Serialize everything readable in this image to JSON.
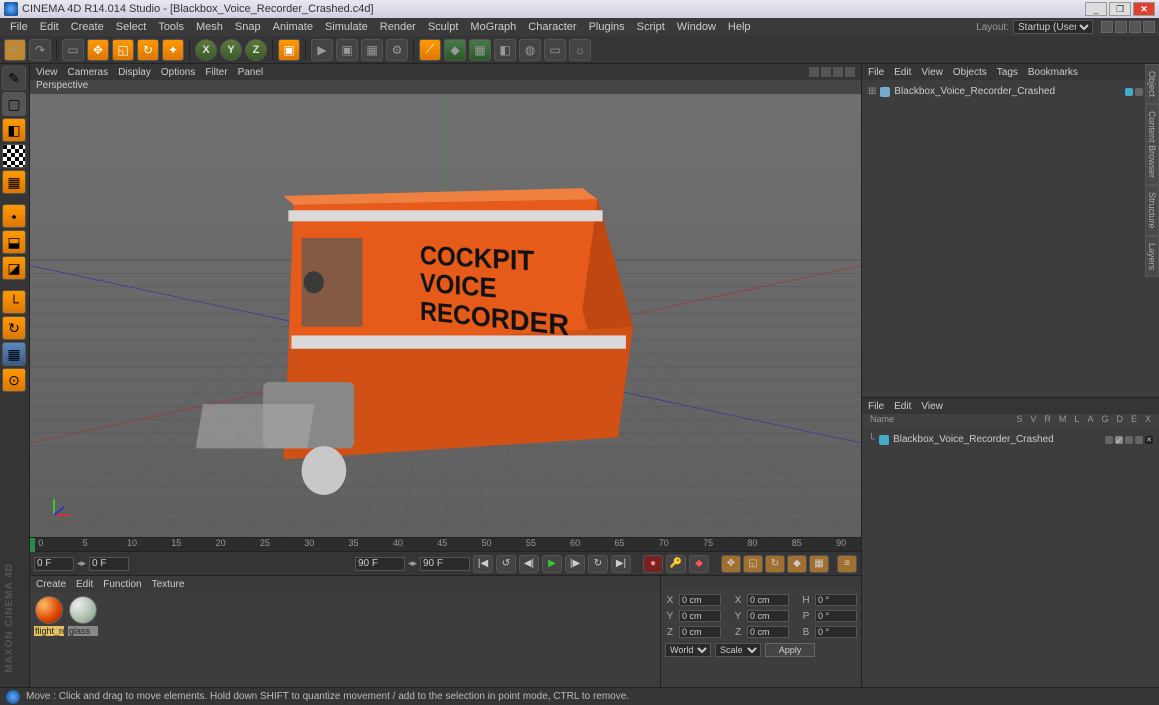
{
  "app": {
    "title": "CINEMA 4D R14.014 Studio - [Blackbox_Voice_Recorder_Crashed.c4d]"
  },
  "menu": [
    "File",
    "Edit",
    "Create",
    "Select",
    "Tools",
    "Mesh",
    "Snap",
    "Animate",
    "Simulate",
    "Render",
    "Sculpt",
    "MoGraph",
    "Character",
    "Plugins",
    "Script",
    "Window",
    "Help"
  ],
  "layout": {
    "label": "Layout:",
    "value": "Startup (User)"
  },
  "viewport": {
    "menu": [
      "View",
      "Cameras",
      "Display",
      "Options",
      "Filter",
      "Panel"
    ],
    "label": "Perspective",
    "model_text": "COCKPIT\nVOICE\nRECORDER"
  },
  "timeline": {
    "start_frame": "0 F",
    "end_frame_in": "90 F",
    "end_frame_out": "90 F",
    "cur_frame": "0 F",
    "ticks": [
      0,
      5,
      10,
      15,
      20,
      25,
      30,
      35,
      40,
      45,
      50,
      55,
      60,
      65,
      70,
      75,
      80,
      85,
      90
    ]
  },
  "materials": {
    "menu": [
      "Create",
      "Edit",
      "Function",
      "Texture"
    ],
    "items": [
      {
        "name": "flight_re",
        "kind": "orange"
      },
      {
        "name": "glass",
        "kind": "glass"
      }
    ]
  },
  "coords": {
    "x": "0 cm",
    "y": "0 cm",
    "z": "0 cm",
    "sx": "0 cm",
    "sy": "0 cm",
    "sz": "0 cm",
    "h": "0 °",
    "p": "0 °",
    "b": "0 °",
    "mode_a": "World",
    "mode_b": "Scale",
    "apply": "Apply"
  },
  "objects": {
    "menu": [
      "File",
      "Edit",
      "View",
      "Objects",
      "Tags",
      "Bookmarks"
    ],
    "items": [
      {
        "name": "Blackbox_Voice_Recorder_Crashed"
      }
    ]
  },
  "attributes": {
    "menu": [
      "File",
      "Edit",
      "View"
    ],
    "name_label": "Name",
    "cols": [
      "S",
      "V",
      "R",
      "M",
      "L",
      "A",
      "G",
      "D",
      "E",
      "X"
    ],
    "item": "Blackbox_Voice_Recorder_Crashed"
  },
  "side_tabs": [
    "Object",
    "Content Browser",
    "Structure",
    "Layers"
  ],
  "watermark": "MAXON CINEMA 4D",
  "status": "Move : Click and drag to move elements. Hold down SHIFT to quantize movement / add to the selection in point mode, CTRL to remove."
}
